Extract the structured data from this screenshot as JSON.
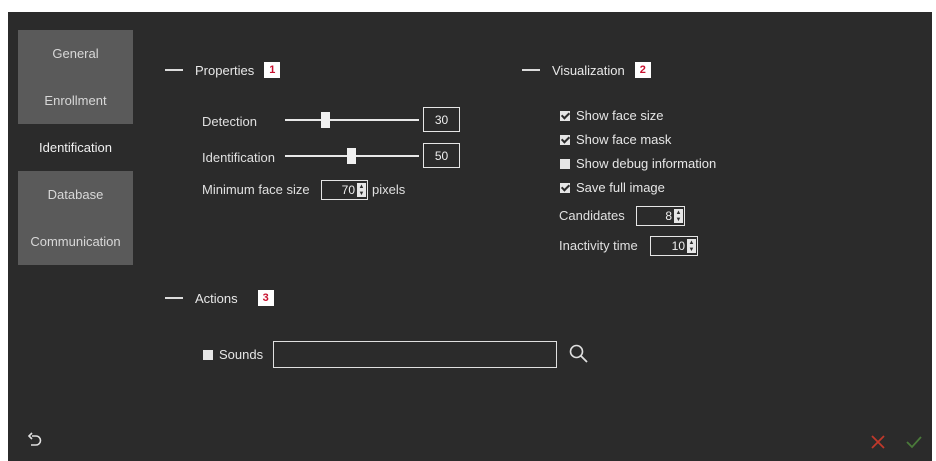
{
  "sidebar": {
    "items": [
      {
        "label": "General"
      },
      {
        "label": "Enrollment"
      },
      {
        "label": "Identification"
      },
      {
        "label": "Database"
      },
      {
        "label": "Communication"
      }
    ]
  },
  "properties": {
    "title": "Properties",
    "badge": "1",
    "detection": {
      "label": "Detection",
      "value": "30"
    },
    "identification": {
      "label": "Identification",
      "value": "50"
    },
    "min_face": {
      "label": "Minimum face size",
      "value": "70",
      "unit": "pixels"
    }
  },
  "visualization": {
    "title": "Visualization",
    "badge": "2",
    "show_face_size": {
      "label": "Show face size",
      "checked": true
    },
    "show_face_mask": {
      "label": "Show face mask",
      "checked": true
    },
    "show_debug": {
      "label": "Show debug information",
      "checked": false
    },
    "save_full_image": {
      "label": "Save full image",
      "checked": true
    },
    "candidates": {
      "label": "Candidates",
      "value": "8"
    },
    "inactivity": {
      "label": "Inactivity time",
      "value": "10"
    }
  },
  "actions": {
    "title": "Actions",
    "badge": "3",
    "sounds": {
      "label": "Sounds",
      "checked": false,
      "value": ""
    }
  },
  "footer": {
    "undo_icon": "undo-icon",
    "cancel_icon": "close-icon",
    "confirm_icon": "check-icon",
    "cancel_color": "#c0392b",
    "confirm_color": "#4a7a3a"
  },
  "colors": {
    "background": "#2b2b2b",
    "sidebar_group": "#5a5a5a",
    "badge_text": "#c8102e"
  }
}
